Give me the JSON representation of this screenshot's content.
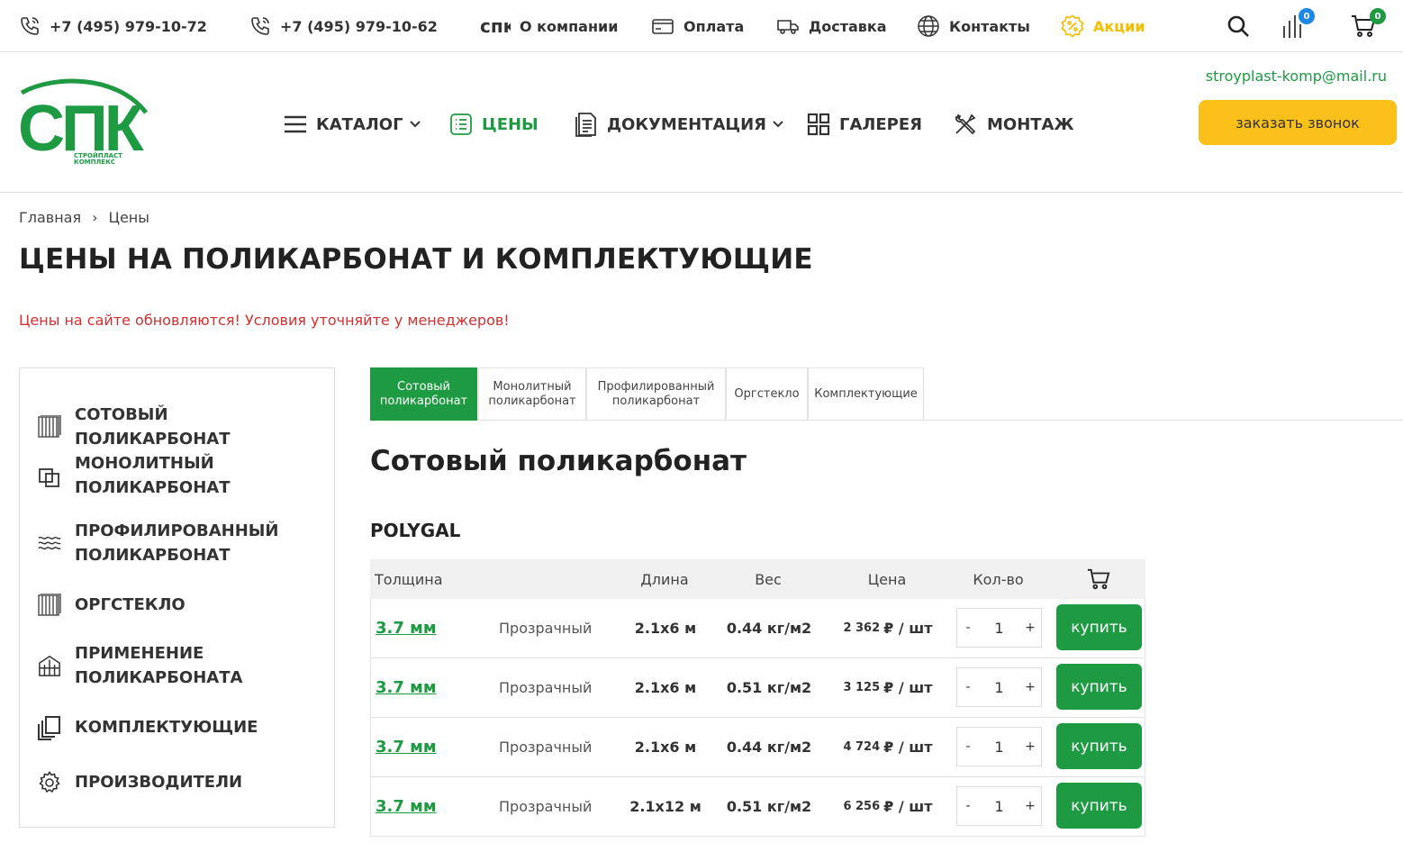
{
  "topbar": {
    "phone1": "+7 (495) 979-10-72",
    "phone2": "+7 (495) 979-10-62",
    "links": [
      {
        "label": "О компании",
        "icon": "spk-mini-icon"
      },
      {
        "label": "Оплата",
        "icon": "wallet-icon"
      },
      {
        "label": "Доставка",
        "icon": "truck-icon"
      },
      {
        "label": "Контакты",
        "icon": "globe-icon"
      },
      {
        "label": "Акции",
        "icon": "percent-badge-icon"
      }
    ],
    "compare_count": "0",
    "cart_count": "0"
  },
  "header": {
    "logo_text": "СПК",
    "logo_subtitle_1": "СТРОЙПЛАСТ",
    "logo_subtitle_2": "КОМПЛЕКС",
    "nav": [
      {
        "label": "КАТАЛОГ"
      },
      {
        "label": "ЦЕНЫ"
      },
      {
        "label": "ДОКУМЕНТАЦИЯ"
      },
      {
        "label": "ГАЛЕРЕЯ"
      },
      {
        "label": "МОНТАЖ"
      }
    ],
    "email": "stroyplast-komp@mail.ru",
    "callback_label": "заказать звонок"
  },
  "breadcrumb": {
    "home": "Главная",
    "sep": "›",
    "current": "Цены"
  },
  "page_title": "ЦЕНЫ НА ПОЛИКАРБОНАТ И КОМПЛЕКТУЮЩИЕ",
  "notice": "Цены на сайте обновляются! Условия уточняйте у менеджеров!",
  "sidebar": [
    {
      "label": "СОТОВЫЙ ПОЛИКАРБОНАТ"
    },
    {
      "label": "МОНОЛИТНЫЙ ПОЛИКАРБОНАТ"
    },
    {
      "label": "ПРОФИЛИРОВАННЫЙ ПОЛИКАРБОНАТ"
    },
    {
      "label": "ОРГСТЕКЛО"
    },
    {
      "label": "ПРИМЕНЕНИЕ ПОЛИКАРБОНАТА"
    },
    {
      "label": "КОМПЛЕКТУЮЩИЕ"
    },
    {
      "label": "ПРОИЗВОДИТЕЛИ"
    }
  ],
  "tabs": [
    {
      "line1": "Сотовый",
      "line2": "поликарбонат"
    },
    {
      "line1": "Монолитный",
      "line2": "поликарбонат"
    },
    {
      "line1": "Профилированный",
      "line2": "поликарбонат"
    },
    {
      "line1": "Оргстекло",
      "line2": ""
    },
    {
      "line1": "Комплектующие",
      "line2": ""
    }
  ],
  "section_title": "Сотовый поликарбонат",
  "brand": "POLYGAL",
  "table": {
    "headers": {
      "thickness": "Толщина",
      "length": "Длина",
      "weight": "Вес",
      "price": "Цена",
      "qty": "Кол-во"
    },
    "rows": [
      {
        "thickness": "3.7 мм",
        "color": "Прозрачный",
        "length": "2.1х6 м",
        "weight": "0.44 кг/м2",
        "price": "2 362",
        "unit": "₽ / шт",
        "qty": "1",
        "buy": "купить"
      },
      {
        "thickness": "3.7 мм",
        "color": "Прозрачный",
        "length": "2.1х6 м",
        "weight": "0.51 кг/м2",
        "price": "3 125",
        "unit": "₽ / шт",
        "qty": "1",
        "buy": "купить"
      },
      {
        "thickness": "3.7 мм",
        "color": "Прозрачный",
        "length": "2.1х6 м",
        "weight": "0.44 кг/м2",
        "price": "4 724",
        "unit": "₽ / шт",
        "qty": "1",
        "buy": "купить"
      },
      {
        "thickness": "3.7 мм",
        "color": "Прозрачный",
        "length": "2.1х12 м",
        "weight": "0.51 кг/м2",
        "price": "6 256",
        "unit": "₽ / шт",
        "qty": "1",
        "buy": "купить"
      }
    ],
    "minus": "-",
    "plus": "+"
  },
  "colors": {
    "brand_green": "#1e9a43",
    "accent_yellow": "#fbc11a",
    "notice_red": "#d32f2f"
  }
}
